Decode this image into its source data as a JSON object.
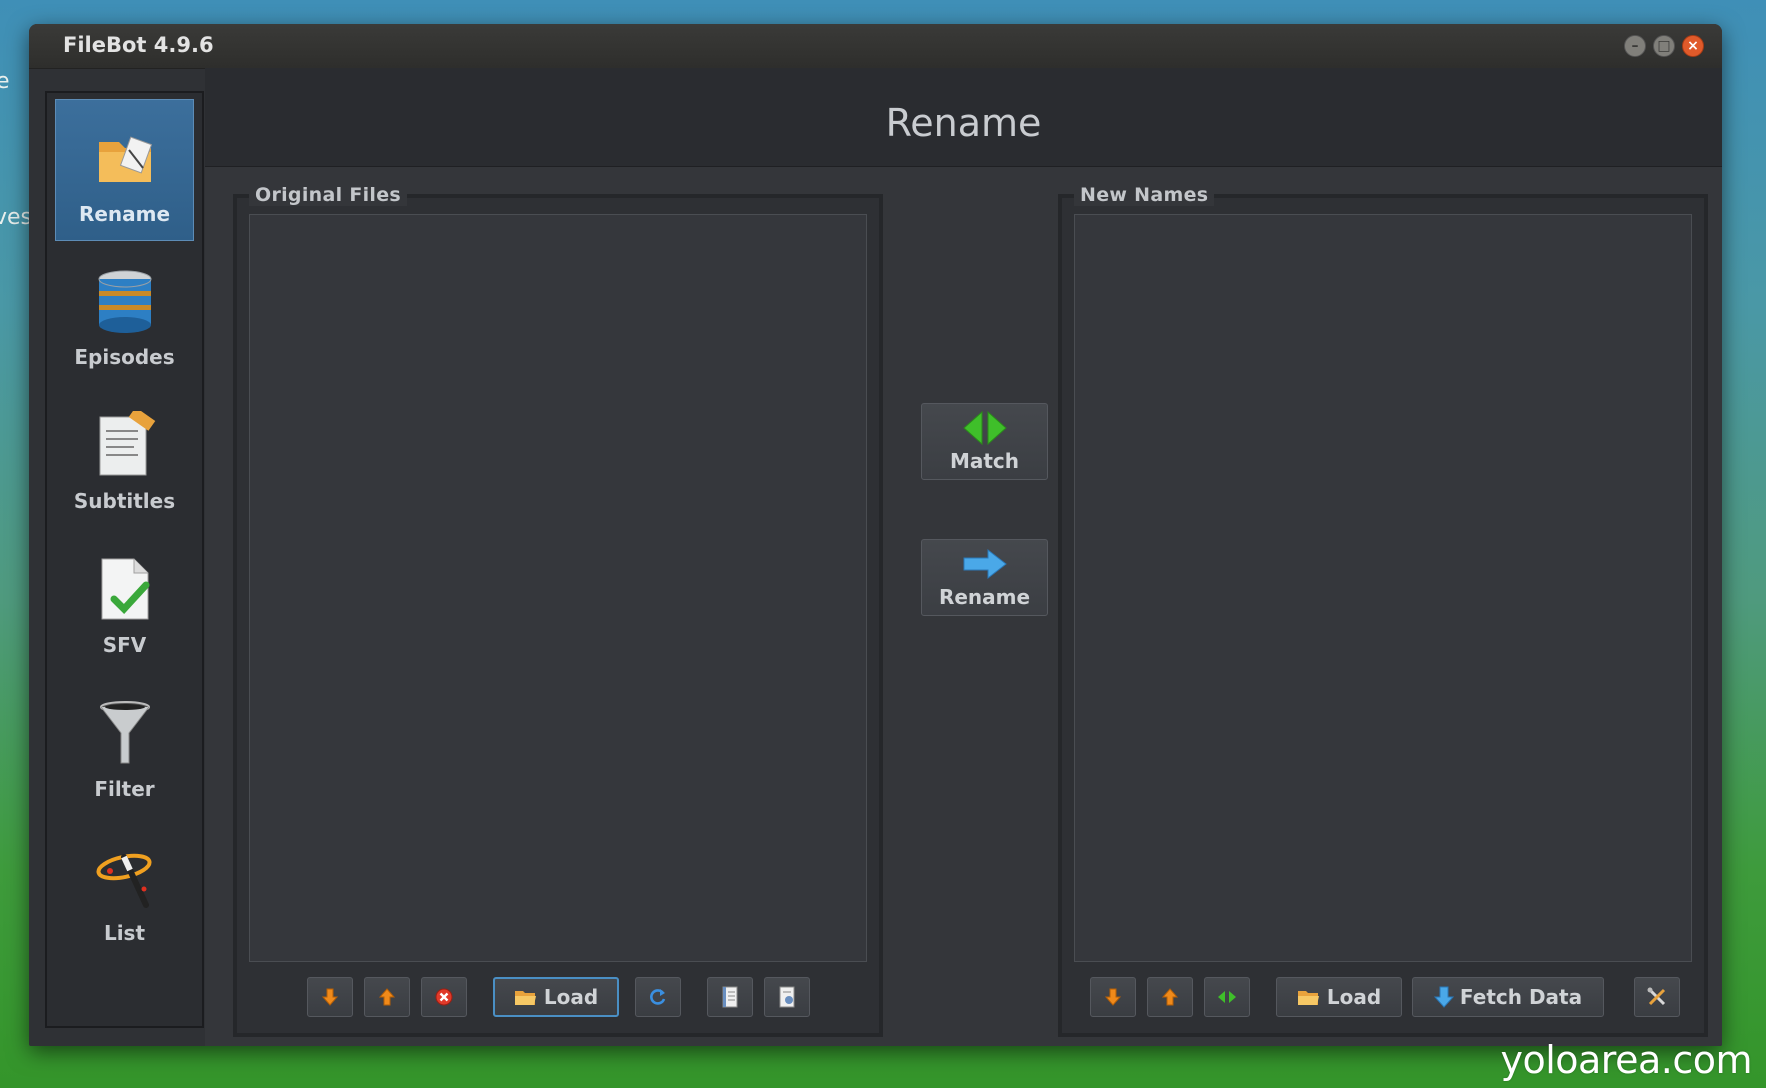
{
  "desktop": {
    "left_fragment_1": "e",
    "left_fragment_2": "ves"
  },
  "watermark": "yoloarea.com",
  "window": {
    "title": "FileBot 4.9.6",
    "controls": [
      "minimize",
      "maximize",
      "close"
    ]
  },
  "sidebar": {
    "items": [
      {
        "label": "Rename",
        "icon": "folder-pen-icon",
        "active": true
      },
      {
        "label": "Episodes",
        "icon": "database-icon",
        "active": false
      },
      {
        "label": "Subtitles",
        "icon": "subtitle-document-icon",
        "active": false
      },
      {
        "label": "SFV",
        "icon": "checked-document-icon",
        "active": false
      },
      {
        "label": "Filter",
        "icon": "funnel-icon",
        "active": false
      },
      {
        "label": "List",
        "icon": "magic-wand-icon",
        "active": false
      }
    ]
  },
  "header": {
    "title": "Rename"
  },
  "original_files": {
    "legend": "Original Files",
    "toolbar": {
      "load_label": "Load"
    }
  },
  "middle": {
    "match_label": "Match",
    "rename_label": "Rename"
  },
  "new_names": {
    "legend": "New Names",
    "toolbar": {
      "load_label": "Load",
      "fetch_label": "Fetch Data"
    }
  },
  "colors": {
    "accent": "#3c6f9c",
    "arrow_orange": "#f08a1a",
    "match_green": "#3fbf2a",
    "rename_blue": "#4aa8e8"
  }
}
